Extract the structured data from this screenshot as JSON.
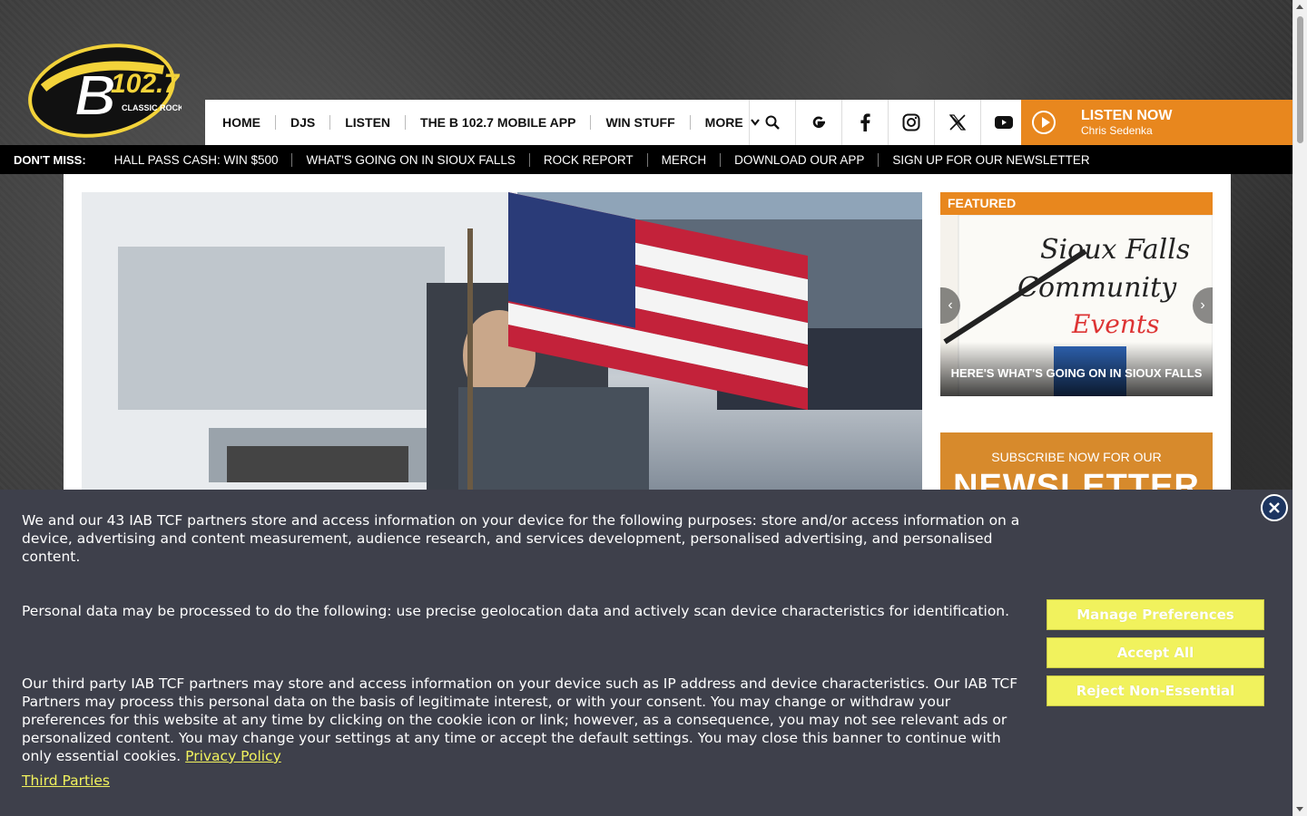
{
  "brand": {
    "logo_text": "B102.7",
    "logo_tagline": "CLASSIC ROCK",
    "accent_color": "#e8871e",
    "cookie_accent": "#f1f25d"
  },
  "nav": {
    "items": [
      "HOME",
      "DJS",
      "LISTEN",
      "THE B 102.7 MOBILE APP",
      "WIN STUFF"
    ],
    "more_label": "MORE",
    "icons": [
      "search-icon",
      "google-icon",
      "facebook-icon",
      "instagram-icon",
      "x-icon",
      "youtube-icon"
    ]
  },
  "listen": {
    "title": "LISTEN NOW",
    "host": "Chris Sedenka"
  },
  "dont_miss": {
    "label": "DON'T MISS:",
    "items": [
      "HALL PASS CASH: WIN $500",
      "WHAT'S GOING ON IN SIOUX FALLS",
      "ROCK REPORT",
      "MERCH",
      "DOWNLOAD OUR APP",
      "SIGN UP FOR OUR NEWSLETTER"
    ]
  },
  "featured": {
    "tag": "FEATURED",
    "image_text_1": "Sioux Falls",
    "image_text_2": "Community",
    "image_text_3": "Events",
    "caption": "HERE'S WHAT'S GOING ON IN SIOUX FALLS"
  },
  "newsletter": {
    "subtitle": "SUBSCRIBE NOW FOR OUR",
    "title": "NEWSLETTER"
  },
  "cookie": {
    "p1": "We and our 43 IAB TCF partners store and access information on your device for the following purposes: store and/or access information on a device, advertising and content measurement, audience research, and services development, personalised advertising, and personalised content.",
    "p2": "Personal data may be processed to do the following: use precise geolocation data and actively scan device characteristics for identification.",
    "p3": "Our third party IAB TCF partners may store and access information on your device such as IP address and device characteristics. Our IAB TCF Partners may process this personal data on the basis of legitimate interest, or with your consent. You may change or withdraw your preferences for this website at any time by clicking on the cookie icon or link; however, as a consequence, you may not see relevant ads or personalized content. You may change your settings at any time or accept the default settings. You may close this banner to continue with only essential cookies.",
    "privacy_link": "Privacy Policy",
    "third_parties_link": "Third Parties",
    "manage_button": "Manage Preferences",
    "accept_button": "Accept All",
    "reject_button": "Reject Non-Essential"
  }
}
